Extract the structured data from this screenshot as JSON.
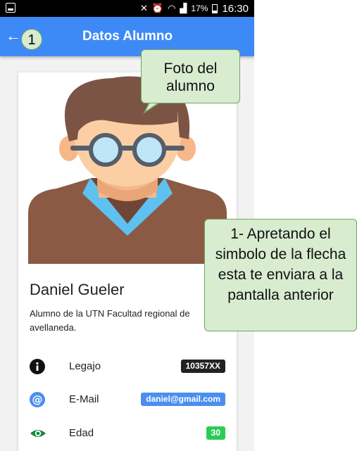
{
  "status_bar": {
    "battery": "17%",
    "time": "16:30"
  },
  "app_bar": {
    "back_glyph": "←",
    "title": "Datos Alumno"
  },
  "annotation_number": "1",
  "profile": {
    "name": "Daniel Gueler",
    "description": "Alumno de la UTN Facultad regional de avellaneda."
  },
  "details": [
    {
      "icon": "info-icon",
      "label": "Legajo",
      "value": "10357XX",
      "color": "#222222"
    },
    {
      "icon": "at-icon",
      "label": "E-Mail",
      "value": "daniel@gmail.com",
      "color": "#4a8ef0"
    },
    {
      "icon": "eye-icon",
      "label": "Edad",
      "value": "30",
      "color": "#2ecc57"
    }
  ],
  "callouts": {
    "photo": "Foto del alumno",
    "back": "1- Apretando el simbolo de la flecha esta te enviara a la pantalla anterior"
  },
  "colors": {
    "app_bar": "#3d8af7",
    "callout_bg": "#d8ecd0",
    "callout_border": "#6fa65d"
  }
}
